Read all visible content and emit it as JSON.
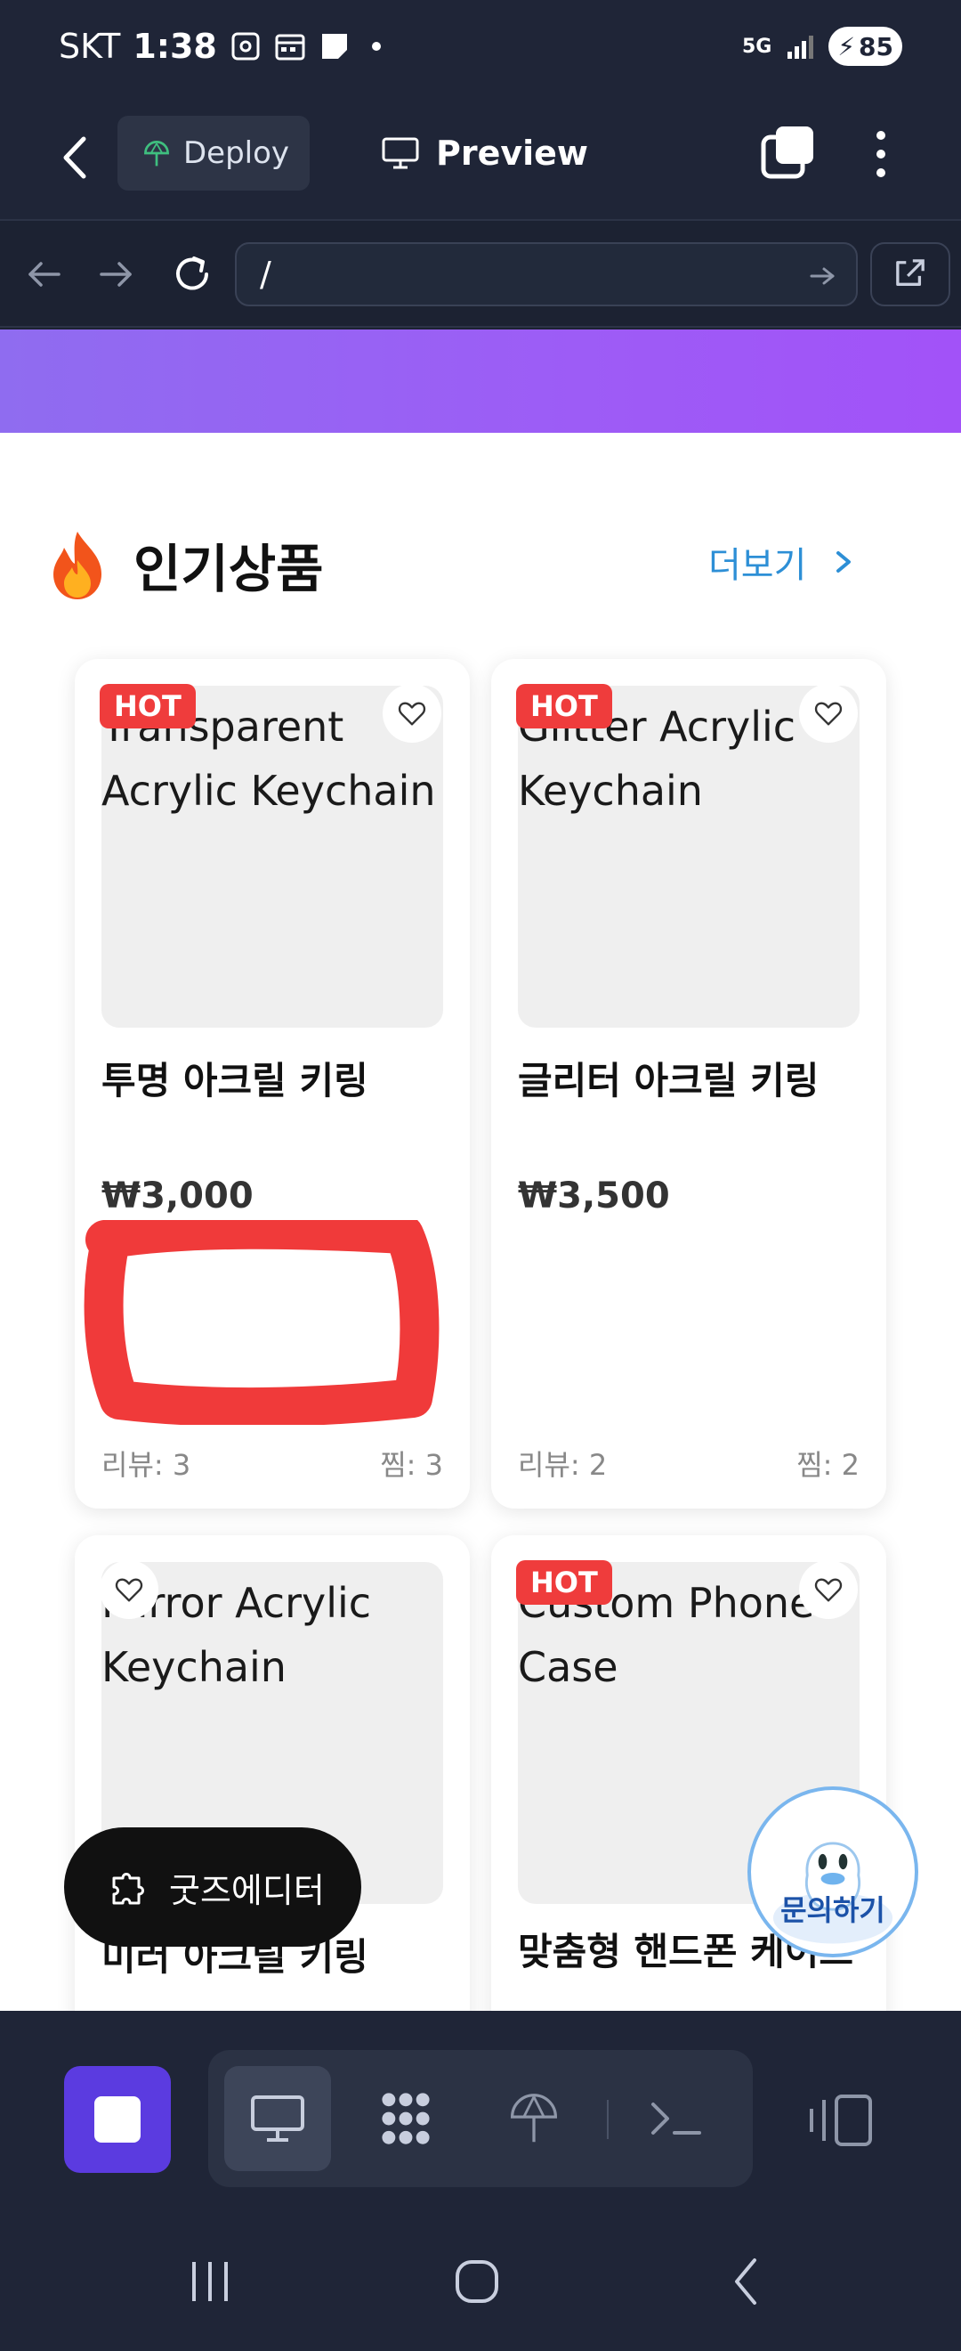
{
  "status_bar": {
    "carrier": "SKT",
    "time": "1:38",
    "network": "5G",
    "battery": "85"
  },
  "app_header": {
    "deploy_label": "Deploy",
    "preview_label": "Preview"
  },
  "browser": {
    "url": "/"
  },
  "section": {
    "title": "인기상품",
    "more_label": "더보기"
  },
  "products": [
    {
      "image_alt": "Transparent Acrylic Keychain",
      "name": "투명 아크릴 키링",
      "price": "₩3,000",
      "badge": "HOT",
      "reviews": "리뷰: 3",
      "likes": "찜: 3"
    },
    {
      "image_alt": "Glitter Acrylic Keychain",
      "name": "글리터 아크릴 키링",
      "price": "₩3,500",
      "badge": "HOT",
      "reviews": "리뷰: 2",
      "likes": "찜: 2"
    },
    {
      "image_alt": "Mirror Acrylic Keychain",
      "name": "미러 아크릴 키링",
      "badge": ""
    },
    {
      "image_alt": "Custom Phone Case",
      "name": "맞춤형 핸드폰 케이스",
      "badge": "HOT"
    }
  ],
  "floating": {
    "goods_editor_label": "굿즈에디터",
    "inquiry_label": "문의하기"
  },
  "colors": {
    "banner_accent": "#9d5cf6",
    "hot_badge": "#ef3c3c",
    "link": "#2d8fd6",
    "stop_button": "#5b3be0",
    "annotation_scribble": "#f03a3a"
  },
  "icons": {
    "status": [
      "screenshot-icon",
      "calendar-icon",
      "note-icon",
      "signal-icon",
      "battery-icon"
    ],
    "toolbar": [
      "stop-icon",
      "desktop-icon",
      "apps-grid-icon",
      "deploy-icon",
      "terminal-icon",
      "panel-toggle-icon"
    ]
  }
}
